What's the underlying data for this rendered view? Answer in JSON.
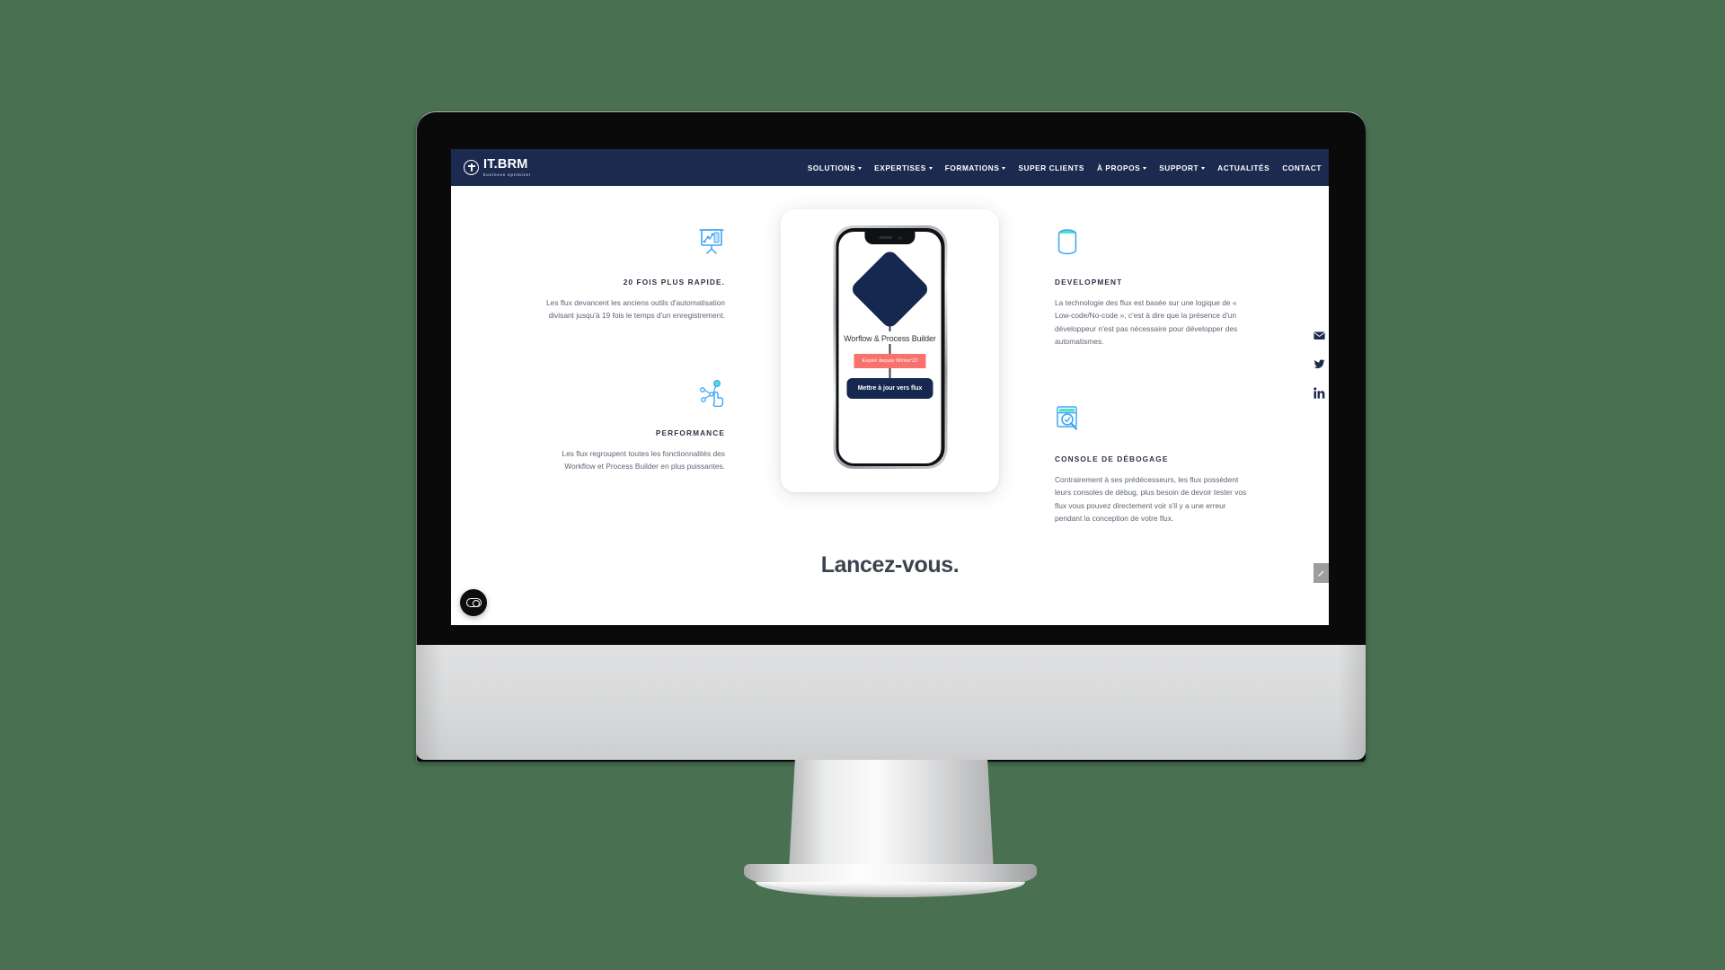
{
  "site": {
    "logo_name": "IT.BRM",
    "logo_tagline": "business optimizer"
  },
  "nav": {
    "items": [
      {
        "label": "SOLUTIONS",
        "caret": true
      },
      {
        "label": "EXPERTISES",
        "caret": true
      },
      {
        "label": "FORMATIONS",
        "caret": true
      },
      {
        "label": "SUPER CLIENTS",
        "caret": false
      },
      {
        "label": "À PROPOS",
        "caret": true
      },
      {
        "label": "SUPPORT",
        "caret": true
      },
      {
        "label": "ACTUALITÉS",
        "caret": false
      },
      {
        "label": "CONTACT",
        "caret": false
      }
    ]
  },
  "features_left": [
    {
      "icon": "presentation-chart-icon",
      "title": "20 FOIS PLUS RAPIDE.",
      "body": "Les flux devancent les anciens outils d'automatisation divisant jusqu'à 19 fois le temps d'un enregistrement."
    },
    {
      "icon": "network-click-icon",
      "title": "PERFORMANCE",
      "body": "Les flux regroupent toutes les fonctionnalités des Workflow et Process Builder en plus puissantes."
    }
  ],
  "features_right": [
    {
      "icon": "database-icon",
      "title": "DEVELOPMENT",
      "body": "La technologie des flux est basée sur une logique de « Low-code/No-code », c'est à dire que la présence d'un développeur n'est pas nécessaire pour développer des automatismes."
    },
    {
      "icon": "debug-console-icon",
      "title": "CONSOLE DE DÉBOGAGE",
      "body": "Contrairement à ses prédécesseurs, les flux possèdent leurs consoles de débug, plus besoin de devoir tester vos flux vous pouvez directement voir s'il y a une erreur pendant la conception de votre flux."
    }
  ],
  "phone": {
    "flow_label": "Worflow & Process Builder",
    "expired_badge": "Expiré depuis Winter'22",
    "cta_label": "Mettre à jour vers flux"
  },
  "headline": "Lancez-vous.",
  "social": [
    {
      "name": "email-icon"
    },
    {
      "name": "twitter-icon"
    },
    {
      "name": "linkedin-icon"
    }
  ],
  "widgets": {
    "cookie_consent": "cookie-consent-toggle",
    "scroll_top": "scroll-to-top-button"
  },
  "colors": {
    "background": "#4a7052",
    "navy": "#1b2a4e",
    "deep_navy": "#15284f",
    "coral": "#f9716d",
    "icon_blue": "#3ea5f5",
    "icon_teal": "#4fe0c8",
    "body_text": "#5d6574",
    "heading_text": "#3d434e"
  }
}
